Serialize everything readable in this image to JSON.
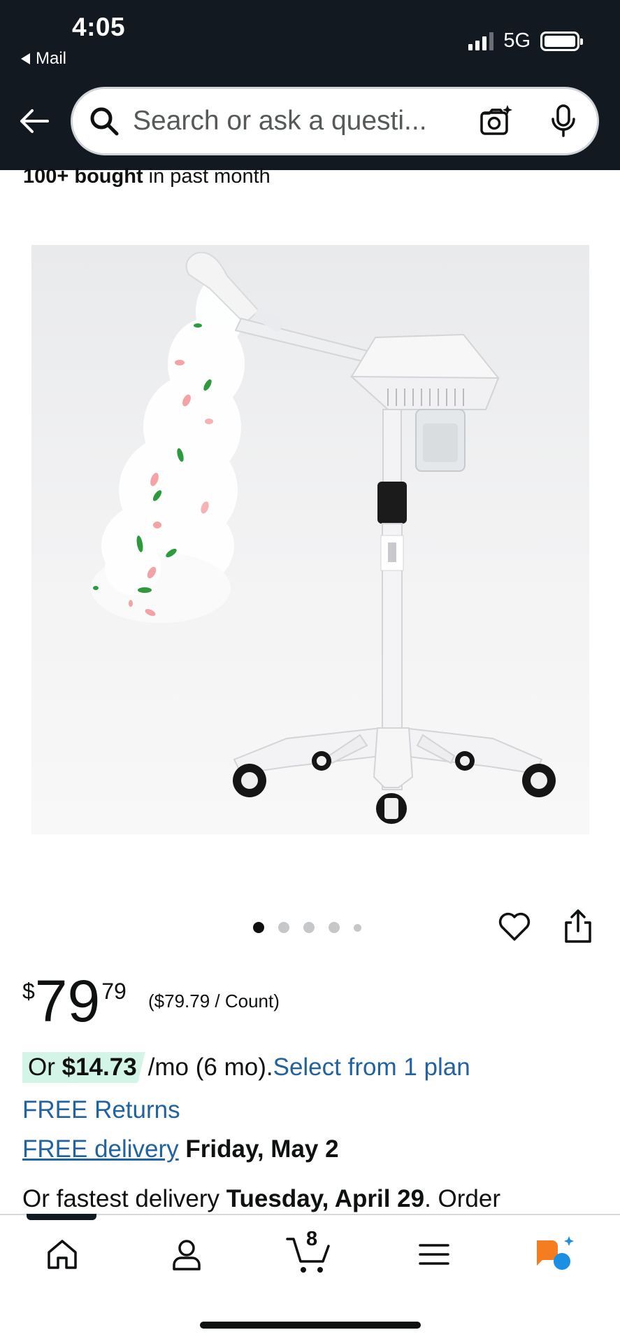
{
  "status_bar": {
    "time": "4:05",
    "back_app": "Mail",
    "network": "5G"
  },
  "search": {
    "placeholder": "Search or ask a questi..."
  },
  "product": {
    "bought_bold": "100+ bought",
    "bought_rest": " in past month",
    "image_count": 5,
    "active_image_index": 0
  },
  "price": {
    "currency": "$",
    "whole": "79",
    "fraction": "79",
    "unit_price": "($79.79 / Count)"
  },
  "installment": {
    "prefix": "Or ",
    "amount": "$14.73",
    "term": " /mo (6 mo). ",
    "link": "Select from 1 plan"
  },
  "returns": {
    "label": "FREE Returns"
  },
  "delivery": {
    "link": "FREE delivery",
    "date": "Friday, May 2"
  },
  "fastest": {
    "prefix": "Or fastest delivery ",
    "date": "Tuesday, April 29",
    "suffix": ". Order"
  },
  "tabbar": {
    "cart_count": "8",
    "items": [
      "home-icon",
      "account-icon",
      "cart-icon",
      "menu-icon",
      "rufus-icon"
    ]
  },
  "colors": {
    "header_bg": "#131921",
    "link": "#2162a1",
    "deal_badge": "#d2f5e8",
    "rufus_orange": "#f57c1f",
    "rufus_blue": "#1a8fe3"
  }
}
